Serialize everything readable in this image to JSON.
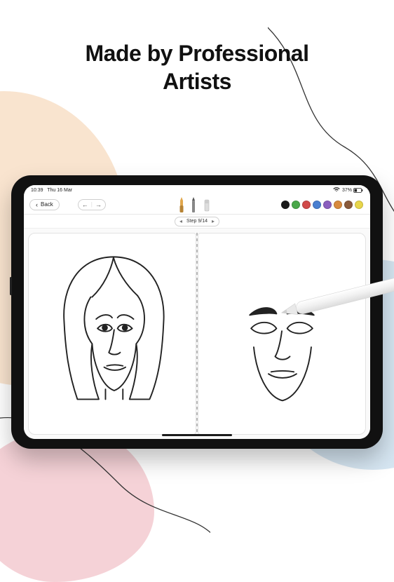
{
  "headline": {
    "line1": "Made by Professional",
    "line2": "Artists"
  },
  "statusbar": {
    "time": "10:39",
    "date": "Thu 16 Mar",
    "battery_pct": "37%"
  },
  "toolbar": {
    "back_label": "Back",
    "tools": [
      "brush",
      "pencil",
      "eraser"
    ]
  },
  "step": {
    "label": "Step 9/14"
  },
  "palette": [
    {
      "name": "black",
      "hex": "#1a1a1a"
    },
    {
      "name": "green",
      "hex": "#4aa84a"
    },
    {
      "name": "red",
      "hex": "#d14a4a"
    },
    {
      "name": "blue",
      "hex": "#4a7fd1"
    },
    {
      "name": "purple",
      "hex": "#8b5fbf"
    },
    {
      "name": "orange",
      "hex": "#d88a3d"
    },
    {
      "name": "brown",
      "hex": "#8a5a3a"
    },
    {
      "name": "yellow",
      "hex": "#e8d64a"
    }
  ]
}
